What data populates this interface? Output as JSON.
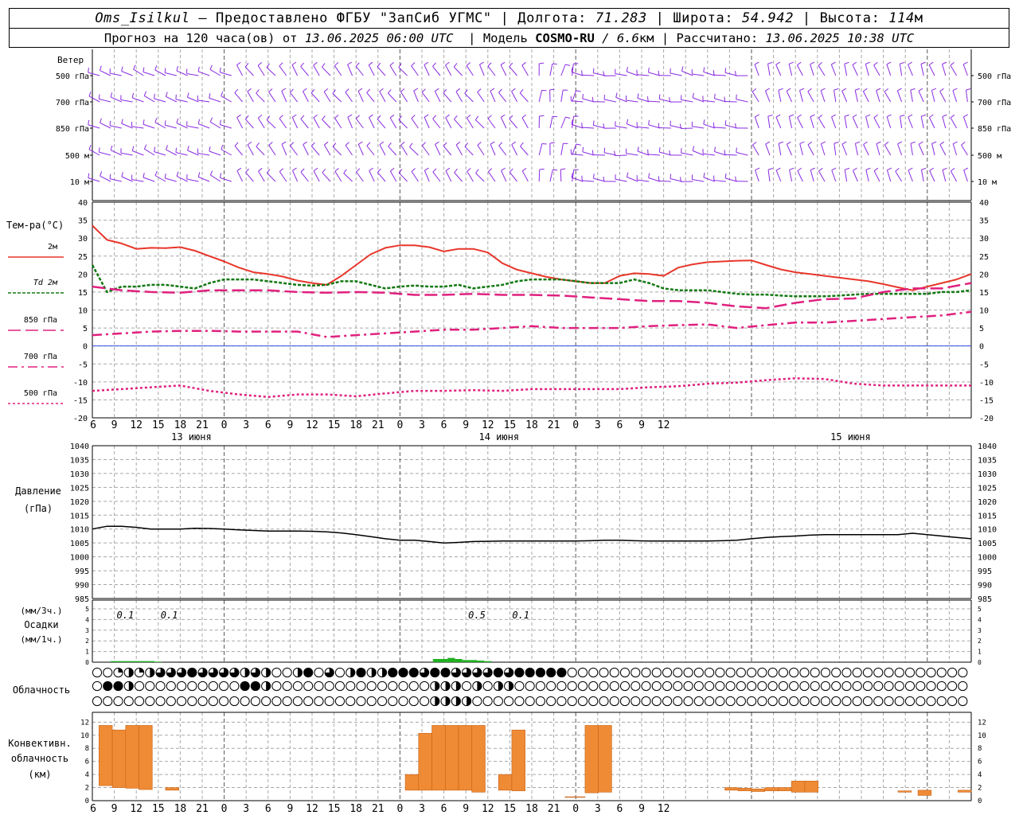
{
  "header": {
    "station": "Oms_Isilkul",
    "sep1": " – ",
    "provider": "Предоставлено ФГБУ \"ЗапСиб УГМС\"",
    "lon_label": "Долгота:",
    "lon_value": "71.283",
    "lat_label": "Широта:",
    "lat_value": "54.942",
    "alt_label": "Высота:",
    "alt_value": "114",
    "alt_unit": "м",
    "forecast_prefix": "Прогноз на 120 часа(ов) от",
    "forecast_time": "13.06.2025 06:00 UTC",
    "model_label": "Модель",
    "model_name": "COSMO-RU",
    "model_res": "/ 6.6",
    "model_res_unit": "км",
    "calc_label": "Рассчитано:",
    "calc_time": "13.06.2025 10:38 UTC"
  },
  "colors": {
    "wind": "#8a2be2",
    "t2m": "#e8362a",
    "td2m": "#127812",
    "t850": "#e0207f",
    "t700": "#e0207f",
    "t500": "#e0207f",
    "pressure": "#000000",
    "precip": "#20b020",
    "convective": "#ef8a35",
    "zero_line": "#3050e0",
    "grid": "#a8a8a8"
  },
  "time_axis": {
    "hour_labels": [
      "6",
      "9",
      "12",
      "15",
      "18",
      "21",
      "0",
      "3",
      "6",
      "9",
      "12",
      "15",
      "18",
      "21",
      "0",
      "3",
      "6",
      "9",
      "12",
      "15",
      "18",
      "21",
      "0",
      "3",
      "6",
      "9",
      "12"
    ],
    "day_labels": [
      "13 июня",
      "14 июня",
      "15 июня"
    ]
  },
  "wind_panel": {
    "title": "Ветер",
    "levels": [
      "500 гПа",
      "700 гПа",
      "850 гПа",
      "500 м",
      "10 м"
    ],
    "right_levels": [
      "500 гПа",
      "700 гПа",
      "850 гПа",
      "500 м",
      "10 м"
    ]
  },
  "temperature_panel": {
    "title": "Тем-ра(°C)",
    "legend": [
      {
        "label_prefix": "",
        "label": "2м"
      },
      {
        "label_prefix": "Td",
        "label": "2м"
      },
      {
        "label_prefix": "",
        "label": "850 гПа"
      },
      {
        "label_prefix": "",
        "label": "700 гПа"
      },
      {
        "label_prefix": "",
        "label": "500 гПа"
      }
    ],
    "y_ticks": [
      "40",
      "35",
      "30",
      "25",
      "20",
      "15",
      "10",
      "5",
      "0",
      "-5",
      "-10",
      "-15",
      "-20"
    ]
  },
  "pressure_panel": {
    "title_line1": "Давление",
    "title_line2": "(гПа)",
    "y_ticks": [
      "1040",
      "1035",
      "1030",
      "1025",
      "1020",
      "1015",
      "1010",
      "1005",
      "1000",
      "995",
      "990",
      "985"
    ]
  },
  "precip_panel": {
    "title_line1": "(мм/3ч.)",
    "title_line2": "Осадки",
    "title_line3": "(мм/1ч.)",
    "y_ticks": [
      "5",
      "4",
      "3",
      "2",
      "1",
      "0"
    ],
    "amount_labels": [
      "0.1",
      "0.1",
      "0.5",
      "0.1"
    ]
  },
  "cloud_panel": {
    "title": "Облачность"
  },
  "convective_panel": {
    "title_line1": "Конвективн.",
    "title_line2": "облачность",
    "title_line3": "(км)",
    "y_ticks": [
      "12",
      "10",
      "8",
      "6",
      "4",
      "2",
      "0"
    ]
  },
  "chart_data": {
    "type": "line",
    "x_unit": "hours since 13.06.2025 06:00 UTC",
    "x_range": [
      0,
      120
    ],
    "series": [
      {
        "name": "2м",
        "panel": "temperature",
        "x": [
          0,
          2,
          4,
          6,
          8,
          10,
          12,
          14,
          16,
          18,
          20,
          22,
          24,
          26,
          28,
          30,
          32,
          34,
          36,
          38,
          40,
          42,
          44,
          46,
          48,
          50,
          52,
          54,
          56,
          58,
          60,
          62,
          64,
          66,
          68,
          70,
          72,
          74,
          76,
          78,
          80,
          82,
          84,
          86,
          88,
          90,
          92,
          94,
          96,
          98,
          100,
          102,
          104,
          106,
          108,
          110,
          112,
          114,
          116,
          118,
          120
        ],
        "y": [
          33.5,
          29.5,
          28.5,
          27,
          27.3,
          27.2,
          27.5,
          26.5,
          25,
          23.5,
          21.8,
          20.5,
          20,
          19.3,
          18.2,
          17.5,
          17,
          19.5,
          22.5,
          25.5,
          27.3,
          28,
          28,
          27.5,
          26.3,
          27,
          27,
          26,
          23,
          21.2,
          20.2,
          19.2,
          18.5,
          18,
          17.5,
          17.5,
          19.5,
          20.2,
          20,
          19.5,
          21.8,
          22.7,
          23.3,
          23.5,
          23.7,
          23.8,
          22.5,
          21.3,
          20.5,
          20,
          19.5,
          19,
          18.5,
          18,
          17.2,
          16.3,
          15.5,
          16.5,
          17.5,
          18.5,
          20
        ]
      },
      {
        "name": "Td 2м",
        "panel": "temperature",
        "x": [
          0,
          2,
          4,
          6,
          8,
          10,
          12,
          14,
          16,
          18,
          20,
          22,
          24,
          26,
          28,
          30,
          32,
          34,
          36,
          38,
          40,
          42,
          44,
          46,
          48,
          50,
          52,
          54,
          56,
          58,
          60,
          62,
          64,
          66,
          68,
          70,
          72,
          74,
          76,
          78,
          80,
          82,
          84,
          86,
          88,
          90,
          92,
          94,
          96,
          98,
          100,
          102,
          104,
          106,
          108,
          110,
          112,
          114,
          116,
          118,
          120
        ],
        "y": [
          22.5,
          15,
          16.5,
          16.5,
          17,
          17,
          16.5,
          16,
          17.5,
          18.5,
          18.5,
          18.5,
          18,
          17.5,
          17,
          16.8,
          17,
          18,
          18,
          17,
          16,
          16.5,
          16.8,
          16.5,
          16.5,
          17,
          16,
          16.5,
          17,
          18,
          18.5,
          18.5,
          18.5,
          18,
          17.5,
          17.5,
          17.5,
          18.5,
          17.5,
          16,
          15.5,
          15.5,
          15.5,
          15,
          14.5,
          14.3,
          14.3,
          14,
          13.8,
          13.8,
          13.8,
          14,
          14.3,
          14.5,
          14.5,
          14.5,
          14.5,
          14.5,
          15,
          15,
          15.5
        ]
      },
      {
        "name": "850 гПа",
        "panel": "temperature",
        "x": [
          0,
          4,
          8,
          12,
          16,
          20,
          24,
          28,
          32,
          36,
          40,
          44,
          48,
          52,
          56,
          60,
          64,
          68,
          72,
          76,
          80,
          84,
          88,
          92,
          96,
          100,
          104,
          108,
          112,
          116,
          120
        ],
        "y": [
          16.5,
          15.5,
          15,
          14.8,
          15.5,
          15.5,
          15.5,
          15,
          14.8,
          15,
          14.8,
          14.2,
          14.2,
          14.5,
          14.2,
          14.2,
          14,
          13.5,
          13,
          12.5,
          12.5,
          12,
          11,
          10.5,
          12,
          13,
          13.2,
          15,
          16,
          16,
          17.5
        ]
      },
      {
        "name": "700 гПа",
        "panel": "temperature",
        "x": [
          0,
          4,
          8,
          12,
          16,
          20,
          24,
          28,
          32,
          36,
          40,
          44,
          48,
          52,
          56,
          60,
          64,
          68,
          72,
          76,
          80,
          84,
          88,
          92,
          96,
          100,
          104,
          108,
          112,
          116,
          120
        ],
        "y": [
          3,
          3.5,
          4,
          4.2,
          4.2,
          4,
          4,
          4,
          2.5,
          3,
          3.5,
          4,
          4.5,
          4.5,
          5,
          5.5,
          5,
          5,
          5,
          5.5,
          5.8,
          6,
          5,
          5.8,
          6.5,
          6.5,
          7,
          7.5,
          8,
          8.5,
          9.5
        ]
      },
      {
        "name": "500 гПа",
        "panel": "temperature",
        "x": [
          0,
          4,
          8,
          12,
          16,
          20,
          24,
          28,
          32,
          36,
          40,
          44,
          48,
          52,
          56,
          60,
          64,
          68,
          72,
          76,
          80,
          84,
          88,
          92,
          96,
          100,
          104,
          108,
          112,
          116,
          120
        ],
        "y": [
          -12.5,
          -12,
          -11.5,
          -11,
          -12.5,
          -13.5,
          -14.2,
          -13.5,
          -13.5,
          -14,
          -13.2,
          -12.5,
          -12.5,
          -12.3,
          -12.5,
          -12,
          -12,
          -12,
          -12,
          -11.5,
          -11.2,
          -10.5,
          -10.2,
          -9.5,
          -9,
          -9.2,
          -10.5,
          -11,
          -11,
          -11,
          -11
        ]
      },
      {
        "name": "Давление",
        "panel": "pressure",
        "x": [
          0,
          2,
          4,
          6,
          8,
          10,
          12,
          14,
          16,
          18,
          20,
          22,
          24,
          26,
          28,
          30,
          32,
          34,
          36,
          38,
          40,
          42,
          44,
          46,
          48,
          50,
          52,
          54,
          56,
          58,
          60,
          62,
          64,
          66,
          68,
          70,
          72,
          74,
          76,
          78,
          80,
          82,
          84,
          86,
          88,
          90,
          92,
          94,
          96,
          98,
          100,
          102,
          104,
          106,
          108,
          110,
          112,
          114,
          116,
          118,
          120
        ],
        "y": [
          1010,
          1011,
          1011,
          1010.6,
          1010,
          1010,
          1010,
          1010.3,
          1010.2,
          1010,
          1009.7,
          1009.5,
          1009.3,
          1009.3,
          1009.3,
          1009.2,
          1009,
          1008.6,
          1008,
          1007.3,
          1006.5,
          1006,
          1006,
          1005.5,
          1005,
          1005.2,
          1005.5,
          1005.6,
          1005.7,
          1005.7,
          1005.7,
          1005.7,
          1005.7,
          1005.7,
          1005.8,
          1006,
          1006,
          1005.8,
          1005.7,
          1005.7,
          1005.7,
          1005.7,
          1005.7,
          1005.8,
          1006,
          1006.5,
          1007,
          1007.3,
          1007.5,
          1007.8,
          1008,
          1008,
          1008,
          1008,
          1008,
          1008,
          1008.5,
          1008,
          1007.5,
          1007,
          1006.5
        ]
      }
    ],
    "precip_mm_per_hour": {
      "x": [
        0,
        1,
        2,
        3,
        4,
        5,
        6,
        7,
        8,
        9,
        10,
        11,
        12,
        13,
        14,
        15,
        16,
        17,
        18,
        19,
        20,
        21,
        22,
        23,
        24,
        25,
        26,
        27,
        28,
        29,
        30,
        31,
        32,
        33,
        34,
        35,
        36,
        37,
        38,
        39,
        40,
        41,
        42,
        43,
        44,
        45,
        46,
        47,
        48,
        49,
        50,
        51,
        52,
        53,
        54
      ],
      "y": [
        0,
        0,
        0,
        0.1,
        0.1,
        0.1,
        0.1,
        0.1,
        0.1,
        0.05,
        0,
        0,
        0,
        0,
        0,
        0,
        0,
        0,
        0,
        0,
        0,
        0,
        0,
        0,
        0,
        0,
        0,
        0,
        0,
        0,
        0,
        0,
        0,
        0,
        0,
        0,
        0,
        0,
        0,
        0,
        0,
        0,
        0,
        0,
        0,
        0,
        0,
        0.3,
        0.3,
        0.4,
        0.3,
        0.2,
        0.2,
        0.15,
        0.1
      ]
    },
    "precip_period_labels": [
      {
        "x": 4.5,
        "value": "0.1"
      },
      {
        "x": 10.5,
        "value": "0.1"
      },
      {
        "x": 52.5,
        "value": "0.5"
      },
      {
        "x": 58.5,
        "value": "0.1"
      }
    ],
    "convective_cloud_km": [
      {
        "x0": 1,
        "x1": 3,
        "base": 2.3,
        "top": 11.5
      },
      {
        "x0": 3,
        "x1": 5,
        "base": 2.0,
        "top": 10.8
      },
      {
        "x0": 5,
        "x1": 7,
        "base": 1.9,
        "top": 11.5
      },
      {
        "x0": 7,
        "x1": 9,
        "base": 1.7,
        "top": 11.5
      },
      {
        "x0": 11,
        "x1": 13,
        "base": 1.6,
        "top": 2.0
      },
      {
        "x0": 47,
        "x1": 49,
        "base": 1.6,
        "top": 4.0
      },
      {
        "x0": 49,
        "x1": 51,
        "base": 1.6,
        "top": 10.3
      },
      {
        "x0": 51,
        "x1": 53,
        "base": 1.6,
        "top": 11.5
      },
      {
        "x0": 53,
        "x1": 55,
        "base": 1.6,
        "top": 11.5
      },
      {
        "x0": 55,
        "x1": 57,
        "base": 1.6,
        "top": 11.5
      },
      {
        "x0": 57,
        "x1": 59,
        "base": 1.3,
        "top": 11.5
      },
      {
        "x0": 61,
        "x1": 63,
        "base": 1.6,
        "top": 4.0
      },
      {
        "x0": 63,
        "x1": 65,
        "base": 1.5,
        "top": 10.8
      },
      {
        "x0": 71,
        "x1": 74,
        "base": 0.5,
        "top": 0.6
      },
      {
        "x0": 74,
        "x1": 76,
        "base": 1.2,
        "top": 11.5
      },
      {
        "x0": 76,
        "x1": 78,
        "base": 1.3,
        "top": 11.5
      },
      {
        "x0": 95,
        "x1": 97,
        "base": 1.6,
        "top": 2.0
      },
      {
        "x0": 97,
        "x1": 99,
        "base": 1.5,
        "top": 1.9
      },
      {
        "x0": 99,
        "x1": 101,
        "base": 1.4,
        "top": 1.8
      },
      {
        "x0": 101,
        "x1": 103,
        "base": 1.5,
        "top": 2.0
      },
      {
        "x0": 103,
        "x1": 105,
        "base": 1.5,
        "top": 2.0
      },
      {
        "x0": 105,
        "x1": 107,
        "base": 1.3,
        "top": 3.0
      },
      {
        "x0": 107,
        "x1": 109,
        "base": 1.3,
        "top": 3.0
      },
      {
        "x0": 121,
        "x1": 123,
        "base": 1.3,
        "top": 1.5
      },
      {
        "x0": 124,
        "x1": 126,
        "base": 0.8,
        "top": 1.6
      },
      {
        "x0": 130,
        "x1": 132,
        "base": 1.3,
        "top": 1.6
      }
    ],
    "cloud_cover_rows": [
      "00121233343333232002403024224443443333434444400000000000000000000000000000000000000",
      "04420000000000442000000000000000222020220000000000000000000000000000000000000000000",
      "00000000000000000000000000000000222200000000000000000000000000000000000000000000000"
    ],
    "wind_levels": [
      "500 гПа",
      "700 гПа",
      "850 гПа",
      "500 м",
      "10 м"
    ]
  }
}
